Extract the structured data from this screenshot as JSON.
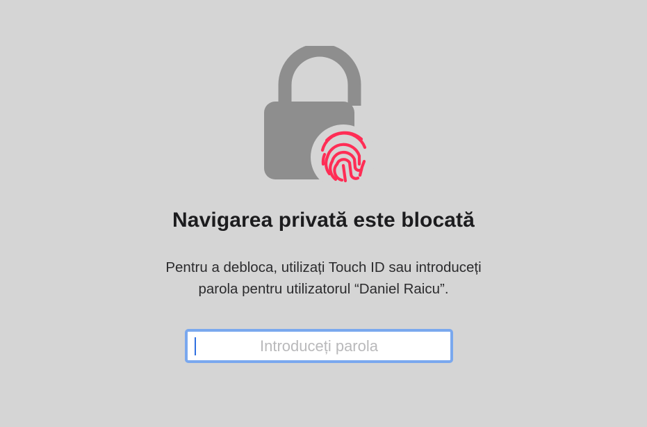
{
  "lock_screen": {
    "title": "Navigarea privată este blocată",
    "message_line_1": "Pentru a debloca, utilizați Touch ID sau introduceți",
    "message_line_2": "parola pentru utilizatorul “Daniel Raicu”.",
    "password_field": {
      "value": "",
      "placeholder": "Introduceți parola"
    }
  },
  "icons": {
    "lock": "lock-icon",
    "touch_id": "fingerprint-icon"
  },
  "colors": {
    "background": "#d5d5d5",
    "lock_gray": "#8e8e8e",
    "fingerprint_red": "#ff2d55",
    "focus_ring": "#7aa8ee"
  }
}
